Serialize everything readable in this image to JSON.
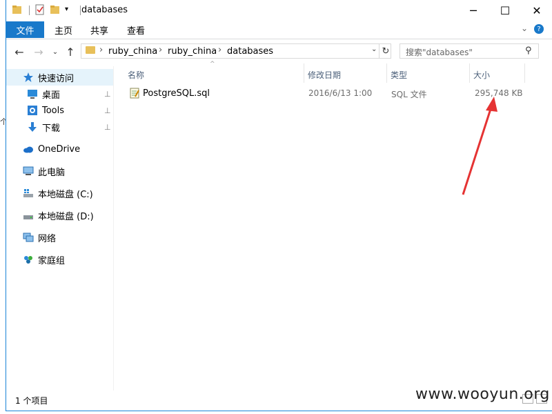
{
  "window": {
    "title": "databases",
    "minimize_glyph": "─",
    "maximize_glyph": "☐",
    "close_glyph": "✕"
  },
  "ribbon": {
    "tabs": [
      {
        "label": "文件"
      },
      {
        "label": "主页"
      },
      {
        "label": "共享"
      },
      {
        "label": "查看"
      }
    ],
    "expand_glyph": "⌄",
    "help_glyph": "?"
  },
  "address_bar": {
    "crumbs": [
      "ruby_china",
      "ruby_china",
      "databases"
    ],
    "separator": "›",
    "dropdown_glyph": "⌄",
    "refresh_glyph": "↻"
  },
  "navigation": {
    "back_glyph": "←",
    "forward_glyph": "→",
    "recent_glyph": "⌄",
    "up_glyph": "↑"
  },
  "search": {
    "placeholder": "搜索\"databases\"",
    "icon_glyph": "⚲"
  },
  "nav_pane": {
    "quick_access": "快速访问",
    "pinned": [
      {
        "label": "桌面"
      },
      {
        "label": "Tools"
      },
      {
        "label": "下载"
      }
    ],
    "pin_glyph": "⊥",
    "onedrive": "OneDrive",
    "this_pc": "此电脑",
    "drive_c": "本地磁盘 (C:)",
    "drive_d": "本地磁盘 (D:)",
    "network": "网络",
    "homegroup": "家庭组"
  },
  "columns": {
    "name": "名称",
    "modified": "修改日期",
    "type": "类型",
    "size": "大小",
    "sort_glyph": "^"
  },
  "files": [
    {
      "name": "PostgreSQL.sql",
      "modified": "2016/6/13 1:00",
      "type": "SQL 文件",
      "size": "295,748 KB"
    }
  ],
  "status_bar": {
    "item_count": "1 个项目"
  },
  "watermark": "www.wooyun.org",
  "colors": {
    "accent": "#1979ca",
    "selection": "#e5f3fb",
    "annotation_arrow": "#e53333",
    "folder": "#e8c05a"
  }
}
